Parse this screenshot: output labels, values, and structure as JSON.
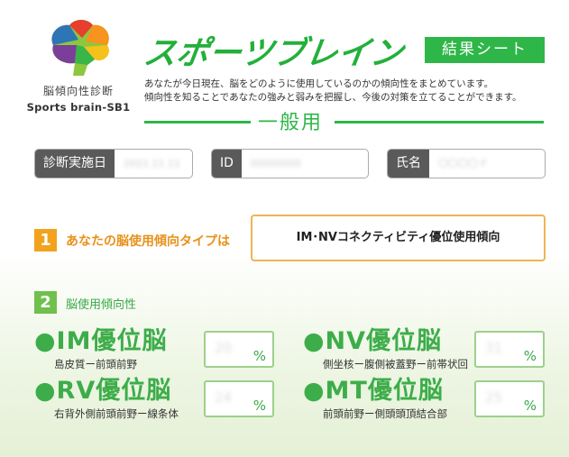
{
  "logo": {
    "icon": "brain-icon",
    "subtitle_jp": "脳傾向性診断",
    "subtitle_en": "Sports brain-SB1"
  },
  "header": {
    "title": "スポーツブレイン",
    "badge": "結果シート",
    "desc_line1": "あなたが今日現在、脳をどのように使用しているのかの傾向性をまとめています。",
    "desc_line2": "傾向性を知ることであなたの強みと弱みを把握し、今後の対策を立てることができます。",
    "section": "一般用"
  },
  "info": {
    "date_label": "診断実施日",
    "date_value": "2021.11.11",
    "id_label": "ID",
    "id_value": "00000000",
    "name_label": "氏名",
    "name_value": "〇〇〇〇 F"
  },
  "q1": {
    "num": "1",
    "heading": "あなたの脳使用傾向タイプは",
    "result": "IM･NVコネクティビティ優位使用傾向"
  },
  "q2": {
    "num": "2",
    "heading": "脳使用傾向性",
    "items": [
      {
        "name": "●IM優位脳",
        "sub": "島皮質ー前頭前野",
        "value": "20",
        "unit": "%"
      },
      {
        "name": "●NV優位脳",
        "sub": "側坐核ー腹側被蓋野ー前帯状回",
        "value": "31",
        "unit": "%"
      },
      {
        "name": "●RV優位脳",
        "sub": "右背外側前頭前野ー線条体",
        "value": "24",
        "unit": "%"
      },
      {
        "name": "●MT優位脳",
        "sub": "前頭前野ー側頭頭頂結合部",
        "value": "25",
        "unit": "%"
      }
    ]
  },
  "colors": {
    "brand_green": "#2fb648",
    "accent_orange": "#f2a21c",
    "light_green": "#6fc04d"
  }
}
